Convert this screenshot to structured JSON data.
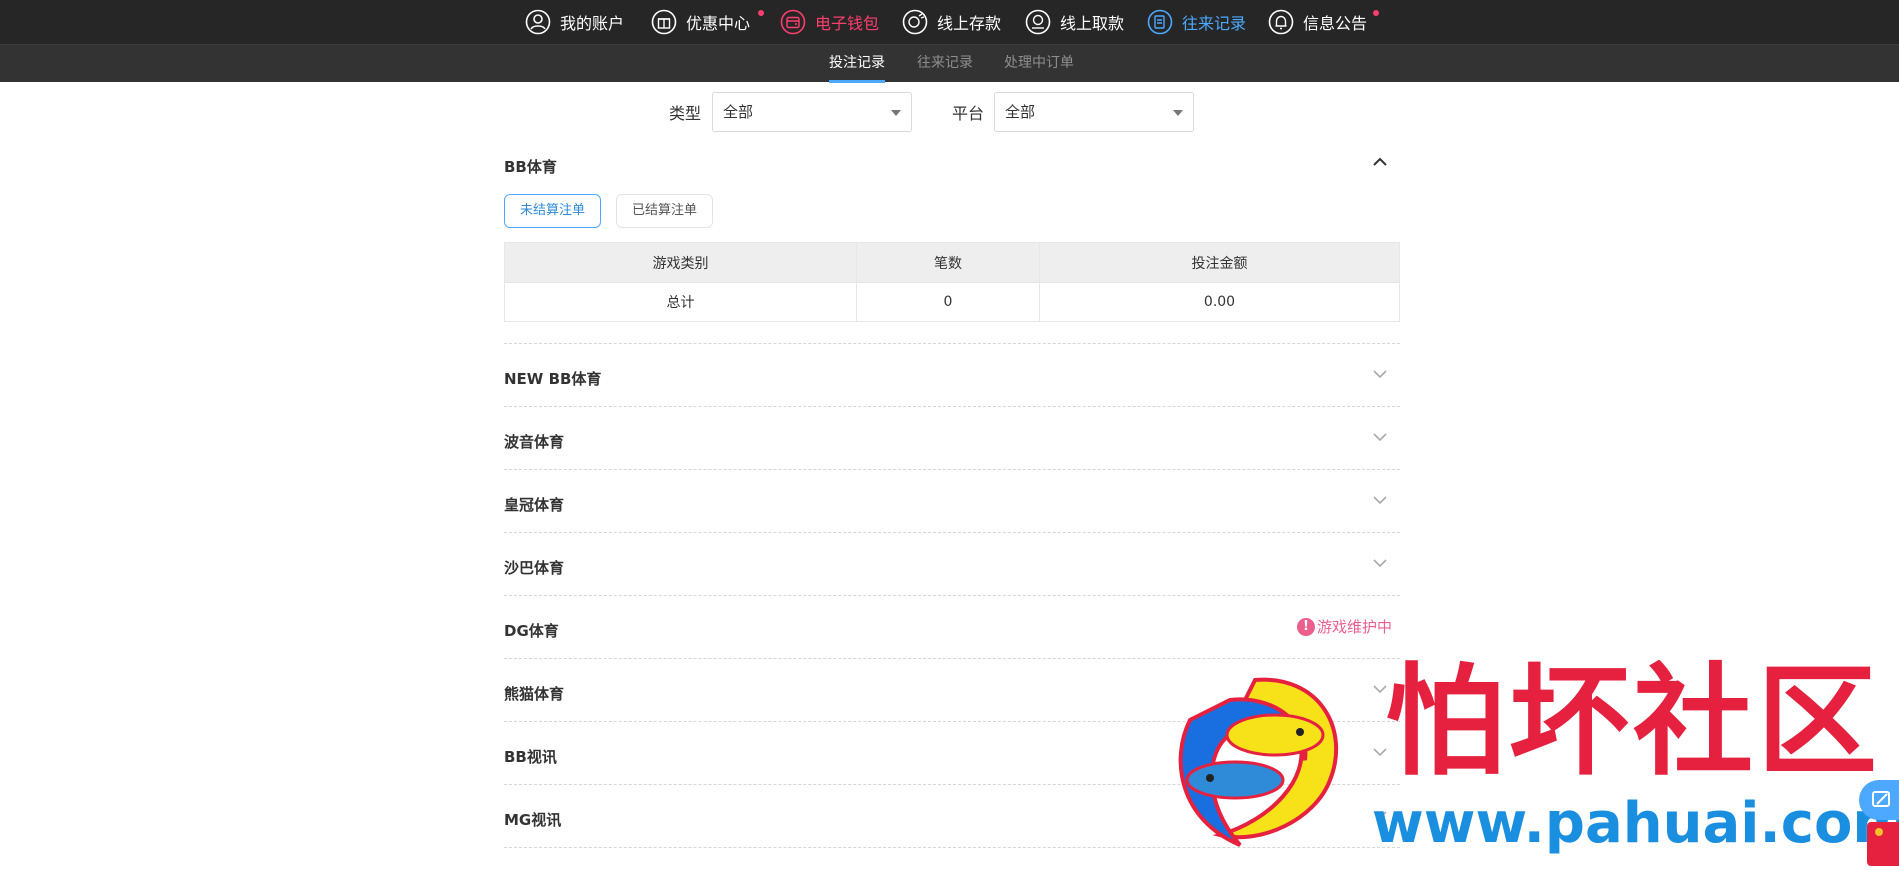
{
  "nav": {
    "items": [
      {
        "label": "我的账户",
        "icon": "user-icon"
      },
      {
        "label": "优惠中心",
        "icon": "gift-icon"
      },
      {
        "label": "电子钱包",
        "icon": "wallet-icon"
      },
      {
        "label": "线上存款",
        "icon": "deposit-icon"
      },
      {
        "label": "线上取款",
        "icon": "withdraw-icon"
      },
      {
        "label": "往来记录",
        "icon": "records-icon"
      },
      {
        "label": "信息公告",
        "icon": "bell-icon"
      }
    ]
  },
  "subnav": {
    "tabs": [
      {
        "label": "投注记录"
      },
      {
        "label": "往来记录"
      },
      {
        "label": "处理中订单"
      }
    ]
  },
  "filters": {
    "type_label": "类型",
    "type_value": "全部",
    "platform_label": "平台",
    "platform_value": "全部"
  },
  "first_section": {
    "title": "BB体育",
    "btn_unsettled": "未结算注单",
    "btn_settled": "已结算注单",
    "table": {
      "headers": [
        "游戏类别",
        "笔数",
        "投注金额"
      ],
      "row": [
        "总计",
        "0",
        "0.00"
      ]
    }
  },
  "sections": [
    {
      "title": "NEW BB体育"
    },
    {
      "title": "波音体育"
    },
    {
      "title": "皇冠体育"
    },
    {
      "title": "沙巴体育"
    },
    {
      "title": "DG体育",
      "status": "游戏维护中"
    },
    {
      "title": "熊猫体育"
    },
    {
      "title": "BB视讯"
    },
    {
      "title": "MG视讯"
    }
  ],
  "watermark": {
    "cn": "怕坏社区",
    "url": "www.pahuai.com"
  },
  "colors": {
    "accent_blue": "#4da8ff",
    "accent_pink": "#ff3d6e",
    "maintenance": "#ec5f8d",
    "topbar": "#262626"
  }
}
